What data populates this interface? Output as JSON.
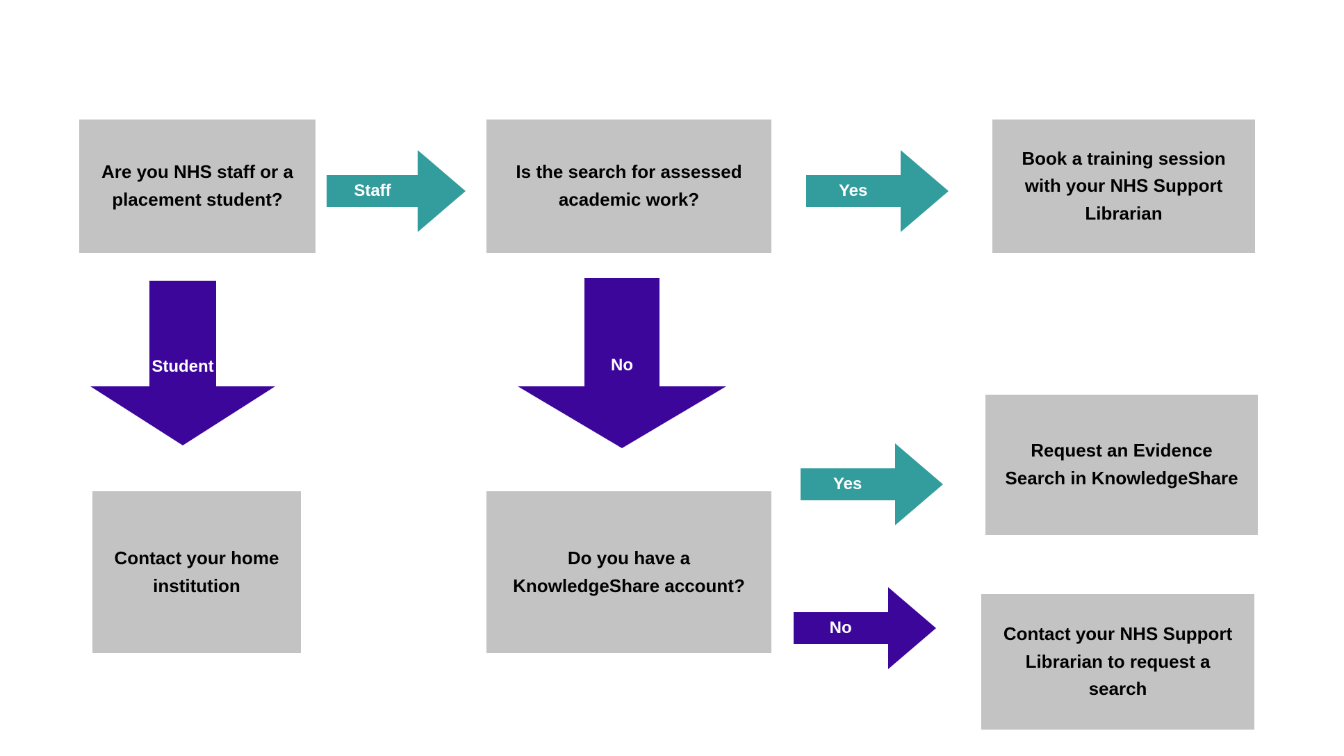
{
  "diagram": {
    "title": "NHS evidence search decision flowchart",
    "background_color": "#ffffff",
    "box_fill": "#c3c3c3",
    "box_text_color": "#000000",
    "teal_color": "#339c9c",
    "purple_color": "#3d069b",
    "arrow_label_color": "#ffffff"
  },
  "nodes": [
    {
      "id": "start-staff-or-student",
      "text": "Are you NHS staff or a\nplacement student?",
      "font_size": 26
    },
    {
      "id": "assessed-academic-work",
      "text": "Is the search for assessed\nacademic work?",
      "font_size": 26
    },
    {
      "id": "book-training-session",
      "text": "Book a training  session\nwith your NHS  Support\nLibrarian",
      "font_size": 26
    },
    {
      "id": "contact-home-institution",
      "text": "Contact your home\ninstitution",
      "font_size": 26
    },
    {
      "id": "knowledgeshare-account",
      "text": "Do you have a\nKnowledgeShare account?",
      "font_size": 26
    },
    {
      "id": "request-evidence-search",
      "text": "Request an Evidence\nSearch in KnowledgeShare",
      "font_size": 26
    },
    {
      "id": "contact-support-librarian",
      "text": "Contact your NHS Support\nLibrarian to request a\nsearch",
      "font_size": 26
    }
  ],
  "arrows": [
    {
      "id": "arrow-staff",
      "label": "Staff",
      "direction": "right",
      "color": "#339c9c",
      "font_size": 24
    },
    {
      "id": "arrow-yes-training",
      "label": "Yes",
      "direction": "right",
      "color": "#339c9c",
      "font_size": 24
    },
    {
      "id": "arrow-student",
      "label": "Student",
      "direction": "down",
      "color": "#3d069b",
      "font_size": 24
    },
    {
      "id": "arrow-no-academic",
      "label": "No",
      "direction": "down",
      "color": "#3d069b",
      "font_size": 24
    },
    {
      "id": "arrow-yes-knowledgeshare",
      "label": "Yes",
      "direction": "right",
      "color": "#339c9c",
      "font_size": 24
    },
    {
      "id": "arrow-no-knowledgeshare",
      "label": "No",
      "direction": "right",
      "color": "#3d069b",
      "font_size": 24
    }
  ]
}
